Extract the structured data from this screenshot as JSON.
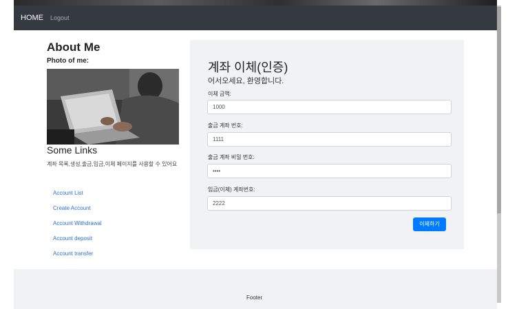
{
  "navbar": {
    "brand": "HOME",
    "logout": "Logout"
  },
  "sidebar": {
    "about_title": "About Me",
    "photo_label": "Photo of me:",
    "links_title": "Some Links",
    "links_desc": "계좌 목록,생성,출금,입금,이체 페이지를 사용할 수 있어요",
    "links": [
      "Account List",
      "Create Account",
      "Account Withdrawal",
      "Account deposit",
      "Account transfer"
    ]
  },
  "form": {
    "title": "계좌 이체(인증)",
    "subtitle": "어서오세요, 환영합니다.",
    "fields": [
      {
        "label": "이체 금액:",
        "value": "1000"
      },
      {
        "label": "출금 계좌 번호:",
        "value": "1111"
      },
      {
        "label": "출금 계좌 비밀 번호:",
        "value": "••••"
      },
      {
        "label": "입금(이체) 계좌번호:",
        "value": "2222"
      }
    ],
    "submit_label": "이체하기"
  },
  "footer": {
    "text": "Footer"
  },
  "colors": {
    "navbar": "#343a40",
    "primary": "#007bff",
    "card": "#f0f2f4"
  }
}
